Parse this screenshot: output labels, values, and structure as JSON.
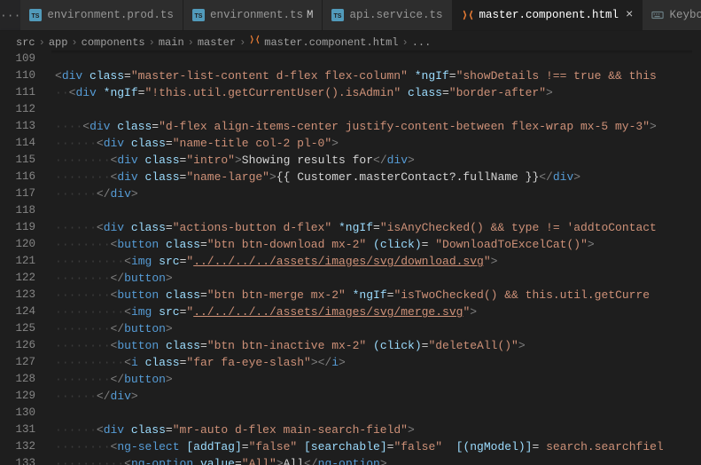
{
  "tabs": {
    "ellipsis": "···",
    "items": [
      {
        "label": "environment.prod.ts",
        "iconColor": "#519aba"
      },
      {
        "label": "environment.ts",
        "iconColor": "#519aba",
        "modified": "M"
      },
      {
        "label": "api.service.ts",
        "iconColor": "#519aba"
      },
      {
        "label": "master.component.html",
        "iconColor": "#e37933",
        "active": true,
        "closable": true
      },
      {
        "label": "Keyboa",
        "iconColor": "#6d8086"
      }
    ]
  },
  "breadcrumb": {
    "parts": [
      "src",
      "app",
      "components",
      "main",
      "master",
      "master.component.html",
      "..."
    ],
    "sep": "›"
  },
  "code": {
    "startLine": 109,
    "lines": [
      {
        "segments": []
      },
      {
        "indent": 0,
        "segments": [
          {
            "c": "p",
            "t": "<"
          },
          {
            "c": "t",
            "t": "div"
          },
          {
            "c": "tx",
            "t": " "
          },
          {
            "c": "a",
            "t": "class"
          },
          {
            "c": "eq",
            "t": "="
          },
          {
            "c": "s",
            "t": "\"master-list-content d-flex flex-column\""
          },
          {
            "c": "tx",
            "t": " "
          },
          {
            "c": "a",
            "t": "*ngIf"
          },
          {
            "c": "eq",
            "t": "="
          },
          {
            "c": "s",
            "t": "\"showDetails !== true && this"
          }
        ]
      },
      {
        "indent": 1,
        "segments": [
          {
            "c": "p",
            "t": "<"
          },
          {
            "c": "t",
            "t": "div"
          },
          {
            "c": "tx",
            "t": " "
          },
          {
            "c": "a",
            "t": "*ngIf"
          },
          {
            "c": "eq",
            "t": "="
          },
          {
            "c": "s",
            "t": "\"!this.util.getCurrentUser().isAdmin\""
          },
          {
            "c": "tx",
            "t": " "
          },
          {
            "c": "a",
            "t": "class"
          },
          {
            "c": "eq",
            "t": "="
          },
          {
            "c": "s",
            "t": "\"border-after\""
          },
          {
            "c": "p",
            "t": ">"
          }
        ]
      },
      {
        "segments": []
      },
      {
        "indent": 2,
        "segments": [
          {
            "c": "p",
            "t": "<"
          },
          {
            "c": "t",
            "t": "div"
          },
          {
            "c": "tx",
            "t": " "
          },
          {
            "c": "a",
            "t": "class"
          },
          {
            "c": "eq",
            "t": "="
          },
          {
            "c": "s",
            "t": "\"d-flex align-items-center justify-content-between flex-wrap mx-5 my-3\""
          },
          {
            "c": "p",
            "t": ">"
          }
        ]
      },
      {
        "indent": 3,
        "segments": [
          {
            "c": "p",
            "t": "<"
          },
          {
            "c": "t",
            "t": "div"
          },
          {
            "c": "tx",
            "t": " "
          },
          {
            "c": "a",
            "t": "class"
          },
          {
            "c": "eq",
            "t": "="
          },
          {
            "c": "s",
            "t": "\"name-title col-2 pl-0\""
          },
          {
            "c": "p",
            "t": ">"
          }
        ]
      },
      {
        "indent": 4,
        "segments": [
          {
            "c": "p",
            "t": "<"
          },
          {
            "c": "t",
            "t": "div"
          },
          {
            "c": "tx",
            "t": " "
          },
          {
            "c": "a",
            "t": "class"
          },
          {
            "c": "eq",
            "t": "="
          },
          {
            "c": "s",
            "t": "\"intro\""
          },
          {
            "c": "p",
            "t": ">"
          },
          {
            "c": "tx",
            "t": "Showing results for"
          },
          {
            "c": "p",
            "t": "</"
          },
          {
            "c": "t",
            "t": "div"
          },
          {
            "c": "p",
            "t": ">"
          }
        ]
      },
      {
        "indent": 4,
        "segments": [
          {
            "c": "p",
            "t": "<"
          },
          {
            "c": "t",
            "t": "div"
          },
          {
            "c": "tx",
            "t": " "
          },
          {
            "c": "a",
            "t": "class"
          },
          {
            "c": "eq",
            "t": "="
          },
          {
            "c": "s",
            "t": "\"name-large\""
          },
          {
            "c": "p",
            "t": ">"
          },
          {
            "c": "tx",
            "t": "{{ Customer.masterContact?.fullName }}"
          },
          {
            "c": "p",
            "t": "</"
          },
          {
            "c": "t",
            "t": "div"
          },
          {
            "c": "p",
            "t": ">"
          }
        ]
      },
      {
        "indent": 3,
        "segments": [
          {
            "c": "p",
            "t": "</"
          },
          {
            "c": "t",
            "t": "div"
          },
          {
            "c": "p",
            "t": ">"
          }
        ]
      },
      {
        "segments": []
      },
      {
        "indent": 3,
        "segments": [
          {
            "c": "p",
            "t": "<"
          },
          {
            "c": "t",
            "t": "div"
          },
          {
            "c": "tx",
            "t": " "
          },
          {
            "c": "a",
            "t": "class"
          },
          {
            "c": "eq",
            "t": "="
          },
          {
            "c": "s",
            "t": "\"actions-button d-flex\""
          },
          {
            "c": "tx",
            "t": " "
          },
          {
            "c": "a",
            "t": "*ngIf"
          },
          {
            "c": "eq",
            "t": "="
          },
          {
            "c": "s",
            "t": "\"isAnyChecked() && type != 'addtoContact"
          }
        ]
      },
      {
        "indent": 4,
        "segments": [
          {
            "c": "p",
            "t": "<"
          },
          {
            "c": "t",
            "t": "button"
          },
          {
            "c": "tx",
            "t": " "
          },
          {
            "c": "a",
            "t": "class"
          },
          {
            "c": "eq",
            "t": "="
          },
          {
            "c": "s",
            "t": "\"btn btn-download mx-2\""
          },
          {
            "c": "tx",
            "t": " "
          },
          {
            "c": "a",
            "t": "(click)"
          },
          {
            "c": "eq",
            "t": "="
          },
          {
            "c": "tx",
            "t": " "
          },
          {
            "c": "s",
            "t": "\"DownloadToExcelCat()\""
          },
          {
            "c": "p",
            "t": ">"
          }
        ]
      },
      {
        "indent": 5,
        "segments": [
          {
            "c": "p",
            "t": "<"
          },
          {
            "c": "t",
            "t": "img"
          },
          {
            "c": "tx",
            "t": " "
          },
          {
            "c": "a",
            "t": "src"
          },
          {
            "c": "eq",
            "t": "="
          },
          {
            "c": "s",
            "t": "\""
          },
          {
            "c": "su",
            "t": "../../../../assets/images/svg/download.svg"
          },
          {
            "c": "s",
            "t": "\""
          },
          {
            "c": "p",
            "t": ">"
          }
        ]
      },
      {
        "indent": 4,
        "segments": [
          {
            "c": "p",
            "t": "</"
          },
          {
            "c": "t",
            "t": "button"
          },
          {
            "c": "p",
            "t": ">"
          }
        ]
      },
      {
        "indent": 4,
        "segments": [
          {
            "c": "p",
            "t": "<"
          },
          {
            "c": "t",
            "t": "button"
          },
          {
            "c": "tx",
            "t": " "
          },
          {
            "c": "a",
            "t": "class"
          },
          {
            "c": "eq",
            "t": "="
          },
          {
            "c": "s",
            "t": "\"btn btn-merge mx-2\""
          },
          {
            "c": "tx",
            "t": " "
          },
          {
            "c": "a",
            "t": "*ngIf"
          },
          {
            "c": "eq",
            "t": "="
          },
          {
            "c": "s",
            "t": "\"isTwoChecked() && this.util.getCurre"
          }
        ]
      },
      {
        "indent": 5,
        "segments": [
          {
            "c": "p",
            "t": "<"
          },
          {
            "c": "t",
            "t": "img"
          },
          {
            "c": "tx",
            "t": " "
          },
          {
            "c": "a",
            "t": "src"
          },
          {
            "c": "eq",
            "t": "="
          },
          {
            "c": "s",
            "t": "\""
          },
          {
            "c": "su",
            "t": "../../../../assets/images/svg/merge.svg"
          },
          {
            "c": "s",
            "t": "\""
          },
          {
            "c": "p",
            "t": ">"
          }
        ]
      },
      {
        "indent": 4,
        "segments": [
          {
            "c": "p",
            "t": "</"
          },
          {
            "c": "t",
            "t": "button"
          },
          {
            "c": "p",
            "t": ">"
          }
        ]
      },
      {
        "indent": 4,
        "segments": [
          {
            "c": "p",
            "t": "<"
          },
          {
            "c": "t",
            "t": "button"
          },
          {
            "c": "tx",
            "t": " "
          },
          {
            "c": "a",
            "t": "class"
          },
          {
            "c": "eq",
            "t": "="
          },
          {
            "c": "s",
            "t": "\"btn btn-inactive mx-2\""
          },
          {
            "c": "tx",
            "t": " "
          },
          {
            "c": "a",
            "t": "(click)"
          },
          {
            "c": "eq",
            "t": "="
          },
          {
            "c": "s",
            "t": "\"deleteAll()\""
          },
          {
            "c": "p",
            "t": ">"
          }
        ]
      },
      {
        "indent": 5,
        "segments": [
          {
            "c": "p",
            "t": "<"
          },
          {
            "c": "t",
            "t": "i"
          },
          {
            "c": "tx",
            "t": " "
          },
          {
            "c": "a",
            "t": "class"
          },
          {
            "c": "eq",
            "t": "="
          },
          {
            "c": "s",
            "t": "\"far fa-eye-slash\""
          },
          {
            "c": "p",
            "t": "></"
          },
          {
            "c": "t",
            "t": "i"
          },
          {
            "c": "p",
            "t": ">"
          }
        ]
      },
      {
        "indent": 4,
        "segments": [
          {
            "c": "p",
            "t": "</"
          },
          {
            "c": "t",
            "t": "button"
          },
          {
            "c": "p",
            "t": ">"
          }
        ]
      },
      {
        "indent": 3,
        "segments": [
          {
            "c": "p",
            "t": "</"
          },
          {
            "c": "t",
            "t": "div"
          },
          {
            "c": "p",
            "t": ">"
          }
        ]
      },
      {
        "segments": []
      },
      {
        "indent": 3,
        "segments": [
          {
            "c": "p",
            "t": "<"
          },
          {
            "c": "t",
            "t": "div"
          },
          {
            "c": "tx",
            "t": " "
          },
          {
            "c": "a",
            "t": "class"
          },
          {
            "c": "eq",
            "t": "="
          },
          {
            "c": "s",
            "t": "\"mr-auto d-flex main-search-field\""
          },
          {
            "c": "p",
            "t": ">"
          }
        ]
      },
      {
        "indent": 4,
        "segments": [
          {
            "c": "p",
            "t": "<"
          },
          {
            "c": "t",
            "t": "ng-select"
          },
          {
            "c": "tx",
            "t": " "
          },
          {
            "c": "a",
            "t": "[addTag]"
          },
          {
            "c": "eq",
            "t": "="
          },
          {
            "c": "s",
            "t": "\"false\""
          },
          {
            "c": "tx",
            "t": " "
          },
          {
            "c": "a",
            "t": "[searchable]"
          },
          {
            "c": "eq",
            "t": "="
          },
          {
            "c": "s",
            "t": "\"false\""
          },
          {
            "c": "tx",
            "t": "  "
          },
          {
            "c": "a",
            "t": "[(ngModel)]"
          },
          {
            "c": "eq",
            "t": "="
          },
          {
            "c": "tx",
            "t": " "
          },
          {
            "c": "s",
            "t": "search.searchfiel"
          }
        ]
      },
      {
        "indent": 5,
        "segments": [
          {
            "c": "p",
            "t": "<"
          },
          {
            "c": "t",
            "t": "ng-option"
          },
          {
            "c": "tx",
            "t": " "
          },
          {
            "c": "a",
            "t": "value"
          },
          {
            "c": "eq",
            "t": "="
          },
          {
            "c": "s",
            "t": "\"All\""
          },
          {
            "c": "p",
            "t": ">"
          },
          {
            "c": "tx",
            "t": "All"
          },
          {
            "c": "p",
            "t": "</"
          },
          {
            "c": "t",
            "t": "ng-option"
          },
          {
            "c": "p",
            "t": ">"
          }
        ]
      }
    ]
  }
}
